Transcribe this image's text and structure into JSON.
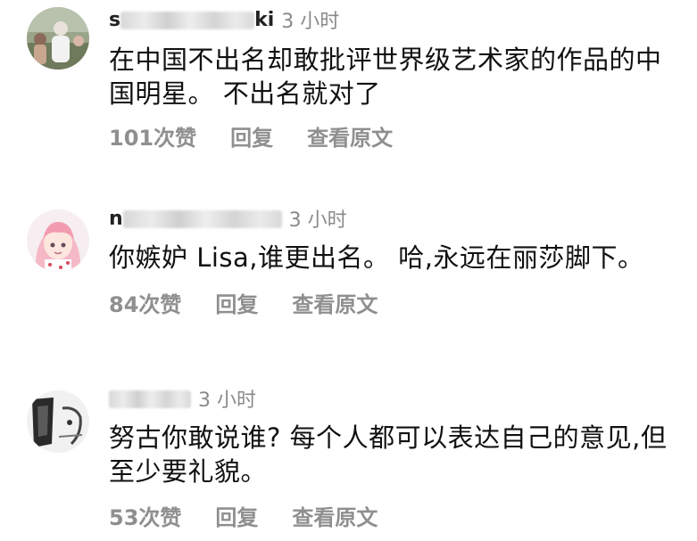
{
  "comments": [
    {
      "username_visible_start": "s",
      "username_visible_end": "ki",
      "time": "3 小时",
      "text": "在中国不出名却敢批评世界级艺术家的作品的中国明星。 不出名就对了",
      "likes": "101次赞",
      "reply": "回复",
      "translate": "查看原文"
    },
    {
      "username_visible_start": "n",
      "username_visible_end": "",
      "time": "3 小时",
      "text": "你嫉妒 Lisa,谁更出名。 哈,永远在丽莎脚下。",
      "likes": "84次赞",
      "reply": "回复",
      "translate": "查看原文"
    },
    {
      "username_visible_start": "",
      "username_visible_end": "",
      "time": "3 小时",
      "text": "努古你敢说谁? 每个人都可以表达自己的意见,但至少要礼貌。",
      "likes": "53次赞",
      "reply": "回复",
      "translate": "查看原文"
    }
  ]
}
